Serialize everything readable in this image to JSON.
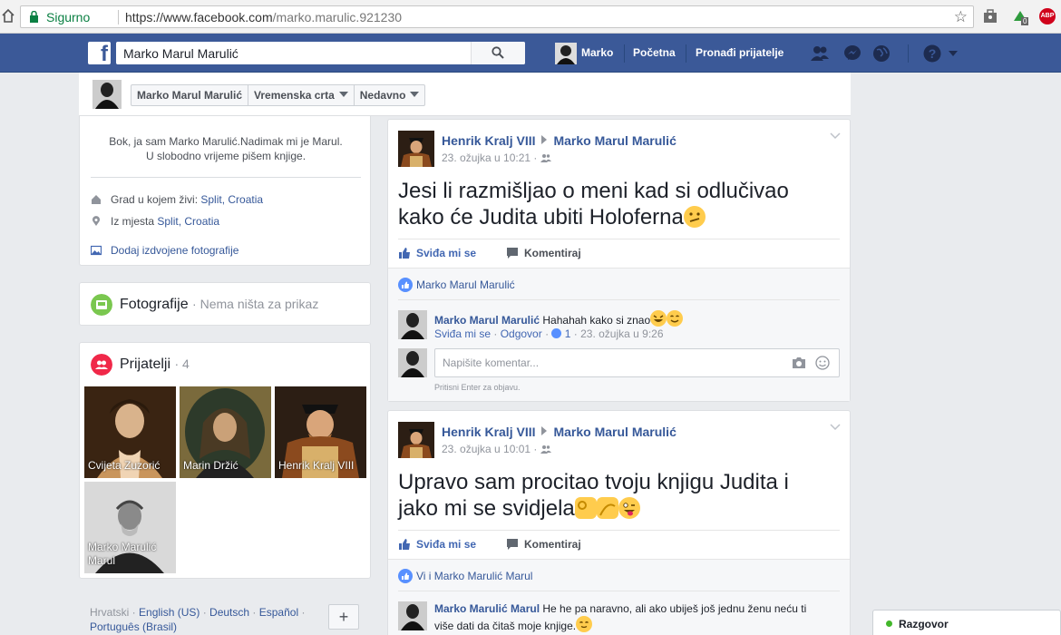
{
  "browser": {
    "secure_label": "Sigurno",
    "url_host": "https://www.facebook.com",
    "url_path": "/marko.marulic.921230",
    "ext_badge": "0",
    "abp_label": "ABP"
  },
  "nav": {
    "search_value": "Marko Marul Marulić",
    "profile_name": "Marko",
    "home": "Početna",
    "find_friends": "Pronađi prijatelje"
  },
  "timeline_header": {
    "name": "Marko Marul Marulić",
    "timeline": "Vremenska crta",
    "recent": "Nedavno"
  },
  "intro": {
    "bio_line1": "Bok, ja sam Marko Marulić.Nadimak mi je Marul.",
    "bio_line2": "U slobodno vrijeme pišem knjige.",
    "lives_label": "Grad u kojem živi:",
    "lives_value": "Split, Croatia",
    "from_label": "Iz mjesta",
    "from_value": "Split, Croatia",
    "add_photos": "Dodaj izdvojene fotografije"
  },
  "photos": {
    "title": "Fotografije",
    "empty": "Nema ništa za prikaz"
  },
  "friends": {
    "title": "Prijatelji",
    "count": "4",
    "list": [
      {
        "name": "Cvijeta Zuzorić"
      },
      {
        "name": "Marin Držić"
      },
      {
        "name": "Henrik Kralj VIII"
      },
      {
        "name": "Marko Marulić Marul"
      }
    ]
  },
  "footer": {
    "lang1": "Hrvatski",
    "lang2": "English (US)",
    "lang3": "Deutsch",
    "lang4": "Español",
    "lang5": "Português (Brasil)",
    "add": "+"
  },
  "posts": [
    {
      "author": "Henrik Kralj VIII",
      "target": "Marko Marul Marulić",
      "time": "23. ožujka u 10:21",
      "text": "Jesi li razmišljao o meni kad si odlučivao kako će Judita ubiti Holoferna",
      "like": "Sviđa mi se",
      "comment": "Komentiraj",
      "likers": "Marko Marul Marulić",
      "comment_author": "Marko Marul Marulić",
      "comment_text": "Hahahah kako si znao",
      "comment_like": "Sviđa mi se",
      "comment_reply": "Odgovor",
      "comment_likes": "1",
      "comment_time": "23. ožujka u 9:26",
      "reply_placeholder": "Napišite komentar...",
      "hint": "Pritisni Enter za objavu."
    },
    {
      "author": "Henrik Kralj VIII",
      "target": "Marko Marul Marulić",
      "time": "23. ožujka u 10:01",
      "text": "Upravo sam procitao tvoju knjigu Judita i jako mi se svidjela",
      "like": "Sviđa mi se",
      "comment": "Komentiraj",
      "likers": "Vi i Marko Marulić Marul",
      "comment_author": "Marko Marulić Marul",
      "comment_text": "He he pa naravno, ali ako ubiješ još jednu ženu neću ti više dati da čitaš moje knjige."
    }
  ],
  "chat": {
    "label": "Razgovor"
  }
}
